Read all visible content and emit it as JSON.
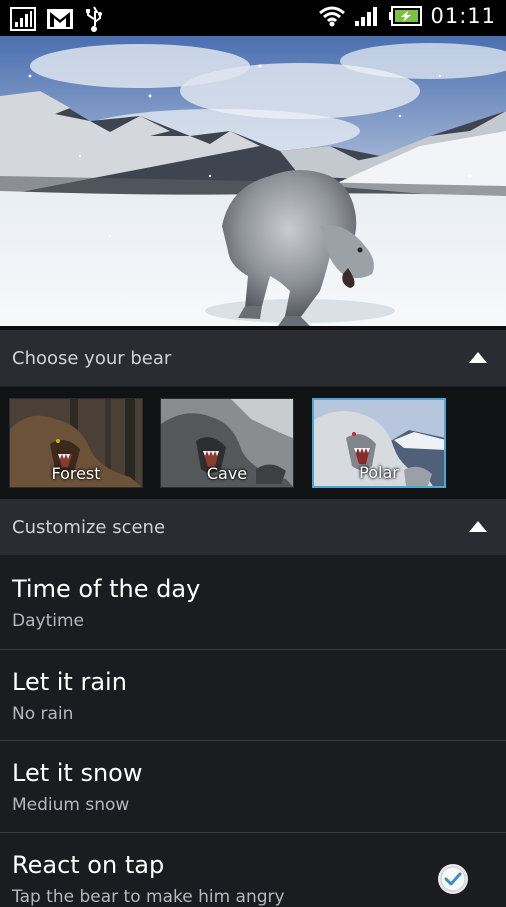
{
  "status_bar": {
    "time": "01:11",
    "icons": [
      "signal-box-icon",
      "gmail-icon",
      "usb-icon",
      "wifi-icon",
      "cell-signal-icon",
      "battery-charging-icon"
    ]
  },
  "sections": {
    "choose_bear": {
      "title": "Choose your bear"
    },
    "customize_scene": {
      "title": "Customize scene"
    }
  },
  "bears": [
    {
      "label": "Forest",
      "selected": false
    },
    {
      "label": "Cave",
      "selected": false
    },
    {
      "label": "Polar",
      "selected": true
    }
  ],
  "settings": [
    {
      "title": "Time of the day",
      "value": "Daytime"
    },
    {
      "title": "Let it rain",
      "value": "No rain"
    },
    {
      "title": "Let it snow",
      "value": "Medium snow"
    },
    {
      "title": "React on tap",
      "value": "Tap the bear to make him angry",
      "checked": true
    }
  ],
  "colors": {
    "accent": "#4aa7d6",
    "header_bg": "#2a2c31",
    "row_bg": "#1b1c20"
  }
}
